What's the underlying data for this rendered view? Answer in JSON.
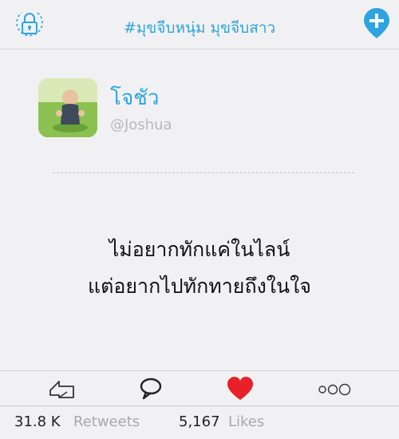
{
  "header": {
    "title": "#มุขจีบหนุ่ม มุขจีบสาว",
    "lock_icon": "lock-icon",
    "add_icon": "add-location-icon",
    "accent": "#2fa3e0"
  },
  "profile": {
    "name": "โจชัว",
    "handle": "@Joshua"
  },
  "post": {
    "line1": "ไม่อยากทักแค่ในไลน์",
    "line2": "แต่อยากไปทักทายถึงในใจ"
  },
  "actions": {
    "retweet_icon": "retweet-icon",
    "reply_icon": "speech-bubble-icon",
    "like_icon": "heart-icon",
    "like_color": "#e8202a",
    "more_icon": "more-icon"
  },
  "stats": {
    "retweets_count": "31.8 K",
    "retweets_label": "Retweets",
    "likes_count": "5,167",
    "likes_label": "Likes"
  }
}
